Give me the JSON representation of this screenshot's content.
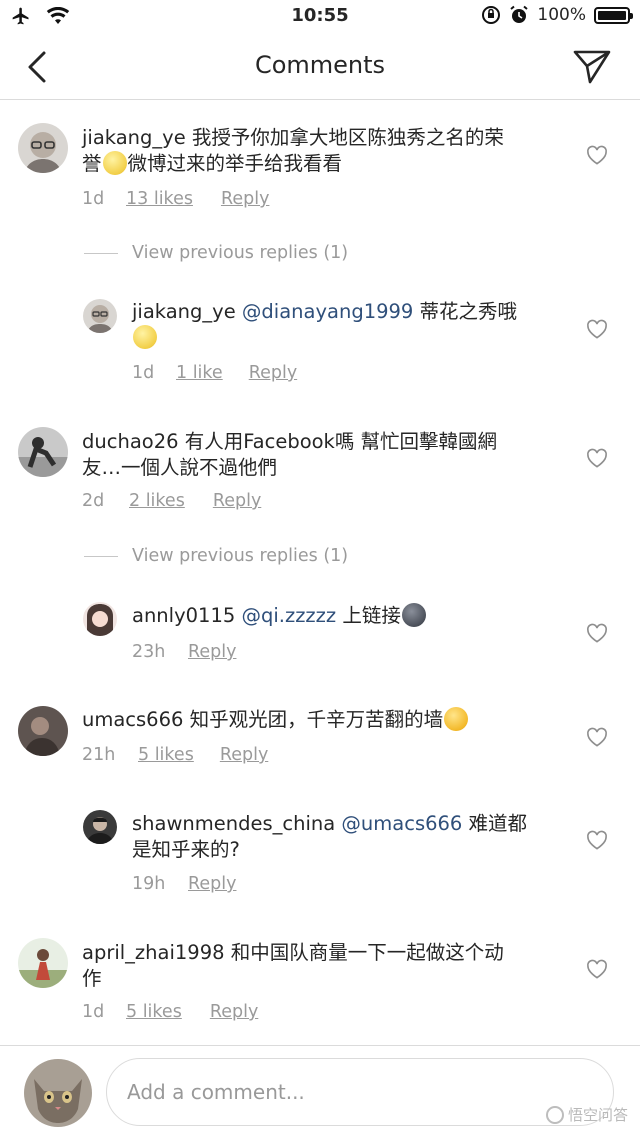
{
  "status_bar": {
    "time": "10:55",
    "battery": "100%"
  },
  "nav": {
    "title": "Comments"
  },
  "comments": [
    {
      "user": "jiakang_ye",
      "text_a": "我授予你加拿大地区陈独秀之名的荣",
      "text_b": "誉",
      "text_c": "微博过来的举手给我看看",
      "time": "1d",
      "likes": "13 likes",
      "reply": "Reply"
    },
    {
      "view_previous": "View previous replies (1)"
    },
    {
      "user": "jiakang_ye",
      "mention": "@dianayang1999",
      "text_a": " 蒂花之秀哦",
      "time": "1d",
      "likes": "1 like",
      "reply": "Reply"
    },
    {
      "user": "duchao26",
      "text_a": "有人用Facebook嗎 幫忙回擊韓國網",
      "text_b": "友…一個人說不過他們",
      "time": "2d",
      "likes": "2 likes",
      "reply": "Reply"
    },
    {
      "view_previous": "View previous replies (1)"
    },
    {
      "user": "annly0115",
      "mention": "@qi.zzzzz",
      "text_a": " 上链接",
      "time": "23h",
      "reply": "Reply"
    },
    {
      "user": "umacs666",
      "text_a": "知乎观光团，千辛万苦翻的墙",
      "time": "21h",
      "likes": "5 likes",
      "reply": "Reply"
    },
    {
      "user": "shawnmendes_china",
      "mention": "@umacs666",
      "text_a": " 难道都",
      "text_b": "是知乎来的?",
      "time": "19h",
      "reply": "Reply"
    },
    {
      "user": "april_zhai1998",
      "text_a": "和中国队商量一下一起做这个动",
      "text_b": "作",
      "time": "1d",
      "likes": "5 likes",
      "reply": "Reply"
    }
  ],
  "input": {
    "placeholder": "Add a comment..."
  },
  "watermark": "悟空问答",
  "icons": {
    "back": "chevron-left-icon",
    "send": "paper-plane-icon",
    "like": "heart-outline-icon"
  }
}
